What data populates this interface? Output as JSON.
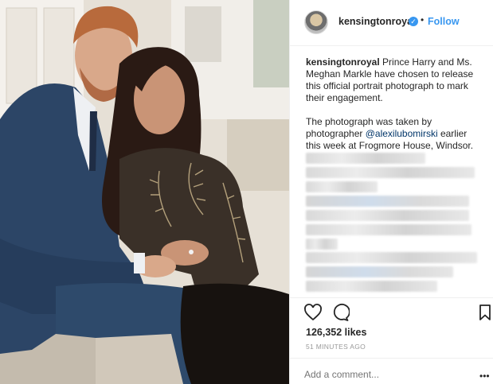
{
  "header": {
    "username": "kensingtonroyal",
    "separator": "•",
    "follow_label": "Follow"
  },
  "caption": {
    "username": "kensingtonroyal",
    "text": "Prince Harry and Ms. Meghan Markle have chosen to release this official portrait photograph to mark their engagement.",
    "para2_before": "The photograph was taken by photographer ",
    "mention": "@alexilubomirski",
    "para2_after": " earlier this week at Frogmore House, Windsor."
  },
  "actions": {
    "like_icon": "heart-icon",
    "comment_icon": "comment-icon",
    "save_icon": "bookmark-icon"
  },
  "likes_text": "126,352 likes",
  "timestamp": "51 MINUTES AGO",
  "comment": {
    "placeholder": "Add a comment...",
    "more_label": "•••"
  },
  "colors": {
    "link_blue": "#3897f0",
    "border": "#efefef",
    "muted_text": "#999999"
  }
}
